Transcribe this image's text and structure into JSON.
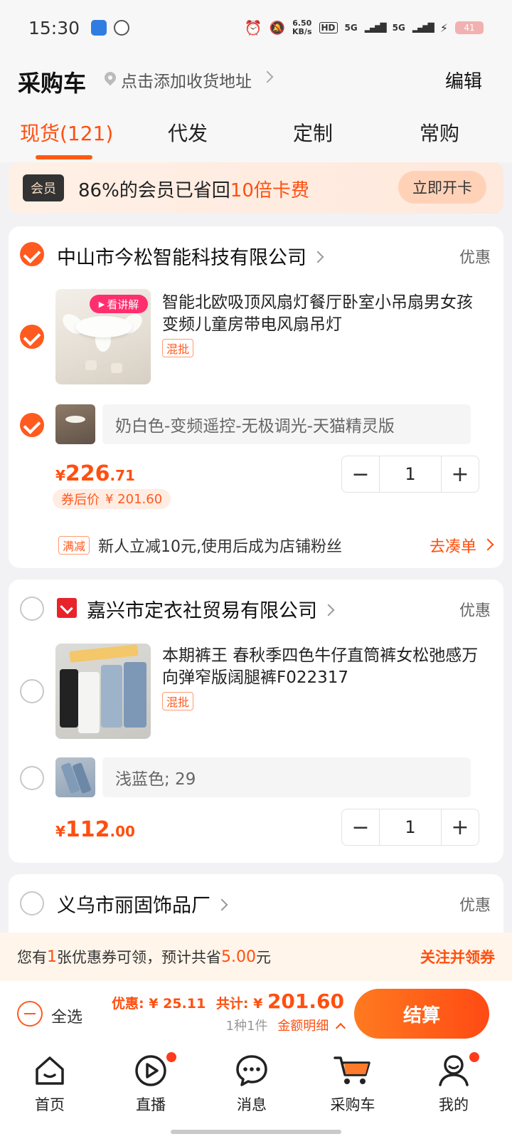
{
  "status_bar": {
    "time": "15:30",
    "net_speed_value": "6.50",
    "net_speed_unit": "KB/s",
    "hd_label": "HD",
    "signal_1": "5G",
    "signal_2": "5G",
    "battery": "41"
  },
  "header": {
    "title": "采购车",
    "address_placeholder": "点击添加收货地址",
    "edit_label": "编辑",
    "tabs": [
      {
        "label": "现货(121)",
        "active": true
      },
      {
        "label": "代发",
        "active": false
      },
      {
        "label": "定制",
        "active": false
      },
      {
        "label": "常购",
        "active": false
      }
    ]
  },
  "member_banner": {
    "badge": "会员",
    "text_prefix": "86%的会员已省回",
    "text_highlight": "10倍卡费",
    "button": "立即开卡"
  },
  "shops": [
    {
      "name": "中山市今松智能科技有限公司",
      "promo_label": "优惠",
      "checked": true,
      "product": {
        "title": "智能北欧吸顶风扇灯餐厅卧室小吊扇男女孩变频儿童房带电风扇吊灯",
        "tag": "混批",
        "live_tag": "看讲解",
        "sku": "奶白色-变频遥控-无极调光-天猫精灵版",
        "price_symbol": "¥",
        "price_int": "226",
        "price_dec": ".71",
        "coupon_price_label": "券后价",
        "coupon_price": "¥ 201.60",
        "quantity": "1"
      },
      "discount": {
        "tag": "满减",
        "text": "新人立减10元,使用后成为店铺粉丝",
        "link": "去凑单"
      }
    },
    {
      "name": "嘉兴市定衣社贸易有限公司",
      "promo_label": "优惠",
      "checked": false,
      "product": {
        "title": "本期裤王 春秋季四色牛仔直筒裤女松弛感万向弹窄版阔腿裤F022317",
        "tag": "混批",
        "sku": "浅蓝色; 29",
        "price_symbol": "¥",
        "price_int": "112",
        "price_dec": ".00",
        "quantity": "1"
      }
    },
    {
      "name": "义乌市丽固饰品厂",
      "promo_label": "优惠",
      "checked": false
    }
  ],
  "coupon_bar": {
    "text_1": "您有",
    "count": "1",
    "text_2": "张优惠券可领，预计共省",
    "amount": "5.00",
    "text_3": "元",
    "action": "关注并领券"
  },
  "checkout": {
    "select_all": "全选",
    "discount_label": "优惠:",
    "discount_value": "¥ 25.11",
    "total_label": "共计:",
    "total_symbol": "¥",
    "total_value": "201.60",
    "count_text": "1种1件",
    "detail_link": "金额明细",
    "pay_button": "结算"
  },
  "nav": [
    {
      "label": "首页",
      "icon": "home-icon"
    },
    {
      "label": "直播",
      "icon": "live-icon",
      "dot": true
    },
    {
      "label": "消息",
      "icon": "message-icon"
    },
    {
      "label": "采购车",
      "icon": "cart-icon"
    },
    {
      "label": "我的",
      "icon": "profile-icon",
      "dot": true
    }
  ],
  "colors": {
    "accent": "#ff4f0f",
    "background": "#f2f2f4",
    "card": "#ffffff",
    "live_tag": "#ff2f6f"
  }
}
